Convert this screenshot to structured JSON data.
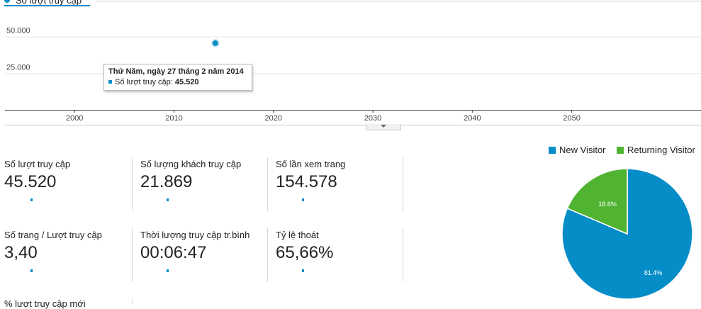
{
  "legend_top": {
    "series_label": "Số lượt truy cập"
  },
  "chart_data": {
    "type": "line",
    "series": [
      {
        "name": "Số lượt truy cập",
        "color": "#058dc7",
        "points": [
          {
            "x": 2014.16,
            "y": 45520
          }
        ]
      }
    ],
    "x_ticks": [
      "2000",
      "2010",
      "2020",
      "2030",
      "2040",
      "2050"
    ],
    "y_ticks": [
      "50.000",
      "25.000"
    ],
    "xlim": [
      1993,
      2063
    ],
    "ylim": [
      0,
      75000
    ],
    "grid": true
  },
  "tooltip": {
    "title": "Thứ Năm, ngày 27 tháng 2 năm 2014",
    "series_label": "Số lượt truy cập:",
    "value": "45.520"
  },
  "metrics": [
    {
      "label": "Số lượt truy cập",
      "value": "45.520"
    },
    {
      "label": "Số lượng khách truy cập",
      "value": "21.869"
    },
    {
      "label": "Số lần xem trang",
      "value": "154.578"
    },
    {
      "label": "Số trang / Lượt truy cập",
      "value": "3,40"
    },
    {
      "label": "Thời lượng truy cập tr.bình",
      "value": "00:06:47"
    },
    {
      "label": "Tỷ lệ thoát",
      "value": "65,66%"
    },
    {
      "label": "% lượt truy cập mới",
      "value": ""
    }
  ],
  "pie": {
    "type": "pie",
    "slices": [
      {
        "name": "New Visitor",
        "value": 81.4,
        "label": "81.4%",
        "color": "#058dc7"
      },
      {
        "name": "Returning Visitor",
        "value": 18.6,
        "label": "18.6%",
        "color": "#50b432"
      }
    ]
  }
}
